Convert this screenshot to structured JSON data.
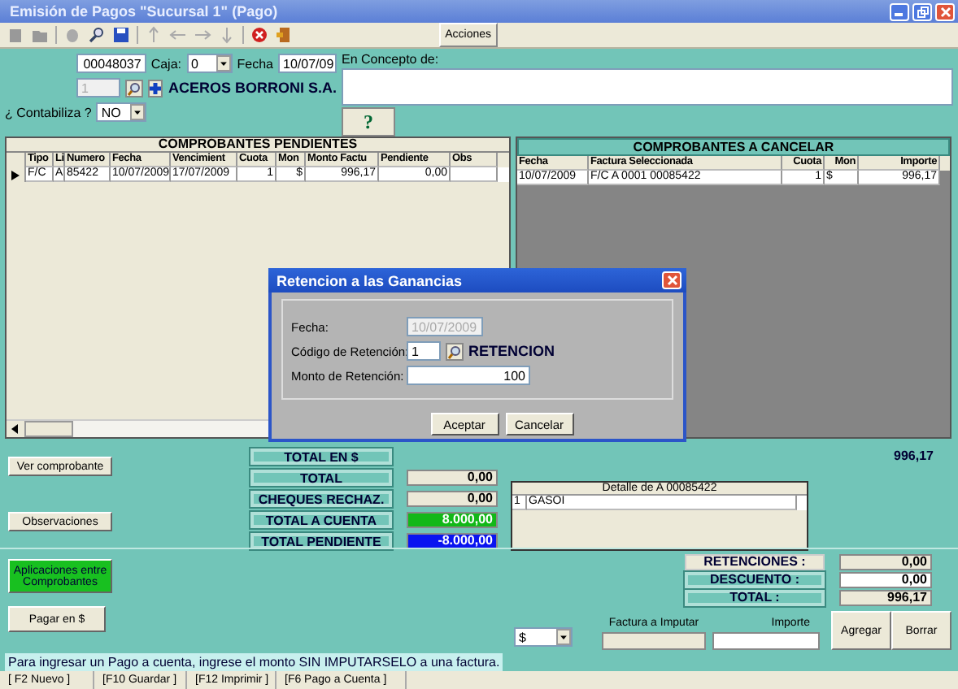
{
  "window": {
    "title": "Emisión de Pagos \"Sucursal 1\" (Pago)"
  },
  "toolbar": {
    "actions": "Acciones"
  },
  "header": {
    "number": "00048037",
    "caja_label": "Caja:",
    "caja": "0",
    "fecha_label": "Fecha",
    "fecha": "10/07/09",
    "provider_code": "1",
    "provider_name": "ACEROS BORRONI S.A.",
    "contabiliza_label": "¿ Contabiliza ?",
    "contabiliza": "NO",
    "concepto_label": "En Concepto de:",
    "help": "?"
  },
  "pending": {
    "title": "COMPROBANTES PENDIENTES",
    "columns": [
      "Tipo",
      "Li",
      "Numero",
      "Fecha",
      "Vencimient",
      "Cuota",
      "Mon",
      "Monto Factu",
      "Pendiente",
      "Obs"
    ],
    "rows": [
      {
        "selected": true,
        "cells": [
          "F/C",
          "A",
          "85422",
          "10/07/2009",
          "17/07/2009",
          "1",
          "$",
          "996,17",
          "0,00",
          ""
        ]
      }
    ]
  },
  "to_cancel": {
    "title": "COMPROBANTES A CANCELAR",
    "columns": [
      "Fecha",
      "Factura Seleccionada",
      "Cuota",
      "Mon",
      "Importe"
    ],
    "rows": [
      {
        "cells": [
          "10/07/2009",
          "F/C A 0001 00085422",
          "1",
          "$",
          "996,17"
        ]
      }
    ]
  },
  "dialog": {
    "title": "Retencion a las Ganancias",
    "fecha_label": "Fecha:",
    "fecha": "10/07/2009",
    "codigo_label": "Código de Retención:",
    "codigo": "1",
    "codigo_name": "RETENCION",
    "monto_label": "Monto de Retención:",
    "monto": "100",
    "buttons": [
      "Aceptar",
      "Cancelar"
    ]
  },
  "left_buttons": [
    "Ver comprobante",
    "Observaciones"
  ],
  "totals": [
    {
      "label": "TOTAL EN $",
      "kind": "none"
    },
    {
      "label": "TOTAL",
      "value": "0,00",
      "kind": "plain"
    },
    {
      "label": "CHEQUES RECHAZ.",
      "value": "0,00",
      "kind": "plain"
    },
    {
      "label": "TOTAL A CUENTA",
      "value": "8.000,00",
      "kind": "positive"
    },
    {
      "label": "TOTAL PENDIENTE",
      "value": "-8.000,00",
      "kind": "negative"
    }
  ],
  "grand_total": "996,17",
  "detail": {
    "title": "Detalle de A 00085422",
    "rows": [
      [
        "1",
        "GASOI"
      ]
    ]
  },
  "apply_button": "Aplicaciones entre Comprobantes",
  "pay_button": "Pagar en $",
  "summary": [
    {
      "label": "RETENCIONES :",
      "value": "0,00"
    },
    {
      "label": "DESCUENTO :",
      "value": "0,00"
    },
    {
      "label": "TOTAL :",
      "value": "996,17"
    }
  ],
  "entry": {
    "currency": "$",
    "invoice_label": "Factura a Imputar",
    "amount_label": "Importe",
    "buttons": [
      "Agregar",
      "Borrar"
    ]
  },
  "message": "Para ingresar un Pago a cuenta, ingrese el monto SIN IMPUTARSELO a una factura.",
  "status_bar": [
    "[ F2 Nuevo ]",
    "[F10 Guardar ]",
    "[F12 Imprimir ]",
    "[F6 Pago a Cuenta ]"
  ]
}
